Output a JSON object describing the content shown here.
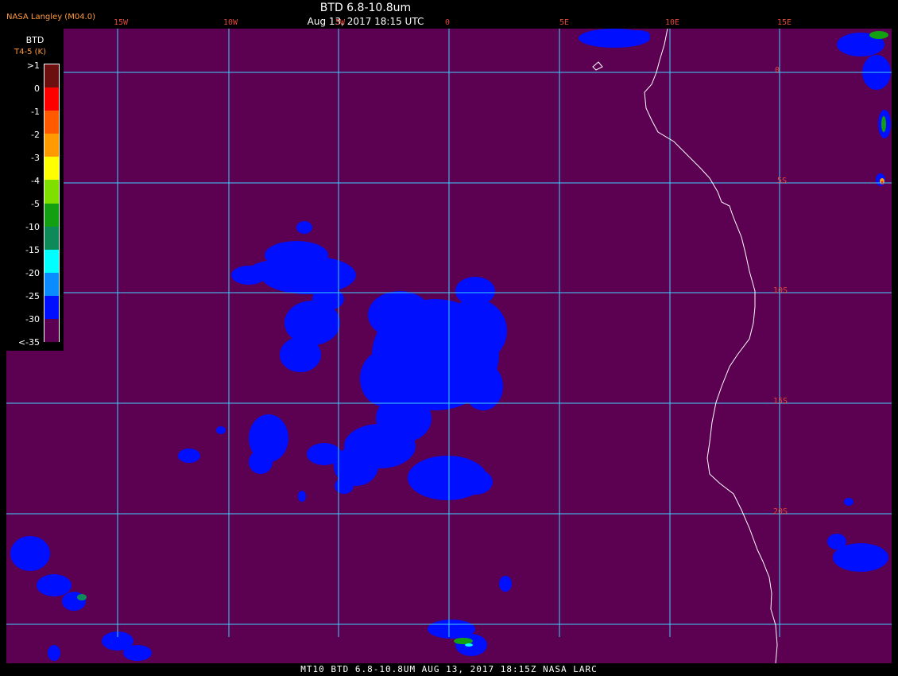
{
  "header": {
    "provider": "NASA Langley (M04.0)",
    "title": "BTD 6.8-10.8um",
    "subtitle": "Aug 13, 2017 18:15 UTC"
  },
  "legend": {
    "title": "BTD",
    "units": "T4-5 (K)",
    "ticks": [
      ">1",
      "0",
      "-1",
      "-2",
      "-3",
      "-4",
      "-5",
      "-10",
      "-15",
      "-20",
      "-25",
      "-30",
      "<-35"
    ],
    "colors": [
      "#6b0f0f",
      "#ff0000",
      "#ff5a00",
      "#ff9a00",
      "#ffff00",
      "#7fe000",
      "#12a012",
      "#0e8a5a",
      "#00ffff",
      "#0a8cff",
      "#0010ff",
      "#5c0052"
    ]
  },
  "axes": {
    "lon_labels": [
      "15W",
      "10W",
      "5W",
      "0",
      "5E",
      "10E",
      "15E"
    ],
    "lat_labels": [
      "0",
      "5S",
      "10S",
      "15S",
      "20S"
    ]
  },
  "map": {
    "background": "#5c0052",
    "gridline_color": "#3fd0ff",
    "cloud_color": "#0010ff",
    "coast_color": "#ffffff"
  },
  "footer": "MT10  BTD 6.8-10.8UM  AUG 13, 2017 18:15Z  NASA LARC"
}
